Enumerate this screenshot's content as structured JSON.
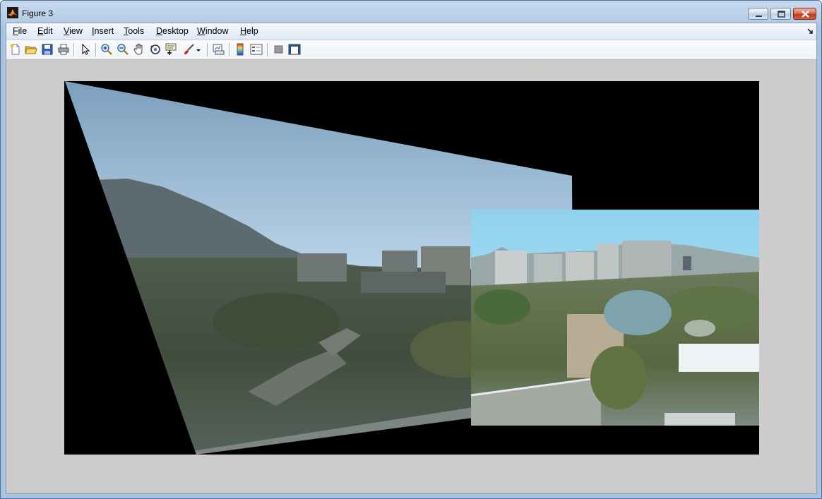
{
  "window": {
    "title": "Figure 3"
  },
  "menu": {
    "items": [
      {
        "label": "File",
        "key": "F"
      },
      {
        "label": "Edit",
        "key": "E"
      },
      {
        "label": "View",
        "key": "V"
      },
      {
        "label": "Insert",
        "key": "I"
      },
      {
        "label": "Tools",
        "key": "T"
      },
      {
        "label": "Desktop",
        "key": "D"
      },
      {
        "label": "Window",
        "key": "W"
      },
      {
        "label": "Help",
        "key": "H"
      }
    ]
  },
  "toolbar": {
    "buttons": [
      "new-figure-icon",
      "open-file-icon",
      "save-icon",
      "print-icon",
      "edit-plot-icon",
      "zoom-in-icon",
      "zoom-out-icon",
      "pan-icon",
      "rotate-3d-icon",
      "data-cursor-icon",
      "brush-icon",
      "brush-dropdown-icon",
      "link-plot-icon",
      "insert-colorbar-icon",
      "insert-legend-icon",
      "hide-plot-tools-icon",
      "show-plot-tools-icon"
    ]
  },
  "figure": {
    "background": "#cccccc",
    "axes_background": "#000000",
    "content": "stitched panorama image"
  }
}
